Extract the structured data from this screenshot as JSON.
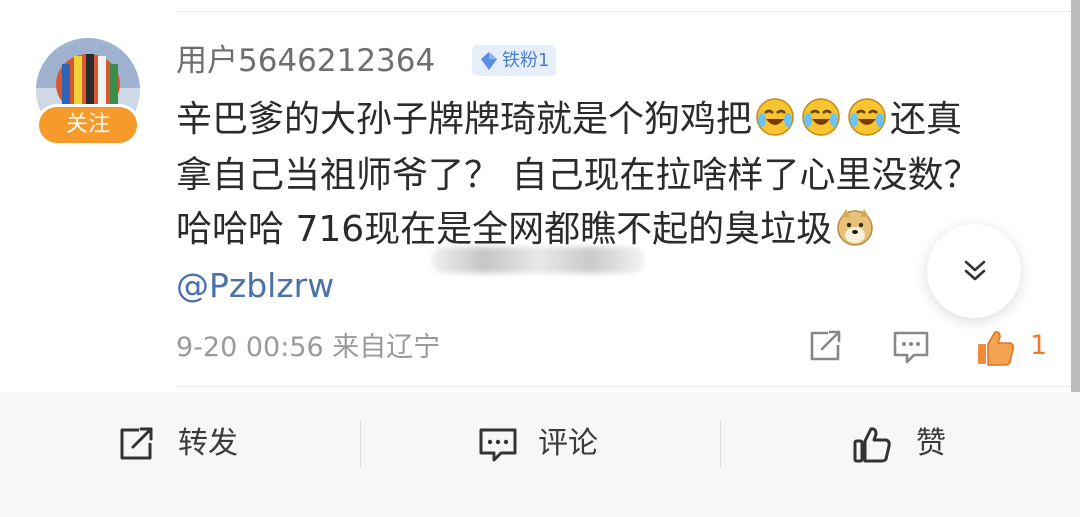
{
  "post": {
    "username": "用户5646212364",
    "fan_badge": "铁粉1",
    "follow_label": "关注",
    "content_line1_text": "辛巴爹的大孙子牌牌琦就是个狗鸡把",
    "content_line1_after": "还真",
    "content_line2": "拿自己当祖师爷了？ 自己现在拉啥样了心里没数？",
    "content_line3_text": "哈哈哈  716现在是全网都瞧不起的臭垃圾",
    "mention": "@Pzblzrw",
    "timestamp": "9-20 00:56",
    "source": "来自辽宁",
    "like_count": "1"
  },
  "icons": {
    "line1_emojis": [
      "laugh-cry-emoji",
      "laugh-cry-emoji",
      "laugh-cry-emoji"
    ],
    "line3_emoji": "doge-emoji"
  },
  "bottom_bar": {
    "repost_label": "转发",
    "comment_label": "评论",
    "like_label": "赞"
  },
  "colors": {
    "follow_button": "#f59a2b",
    "mention_link": "#4a71a8",
    "like_active": "#f07a2a",
    "fan_badge_bg": "#e5eef9"
  }
}
